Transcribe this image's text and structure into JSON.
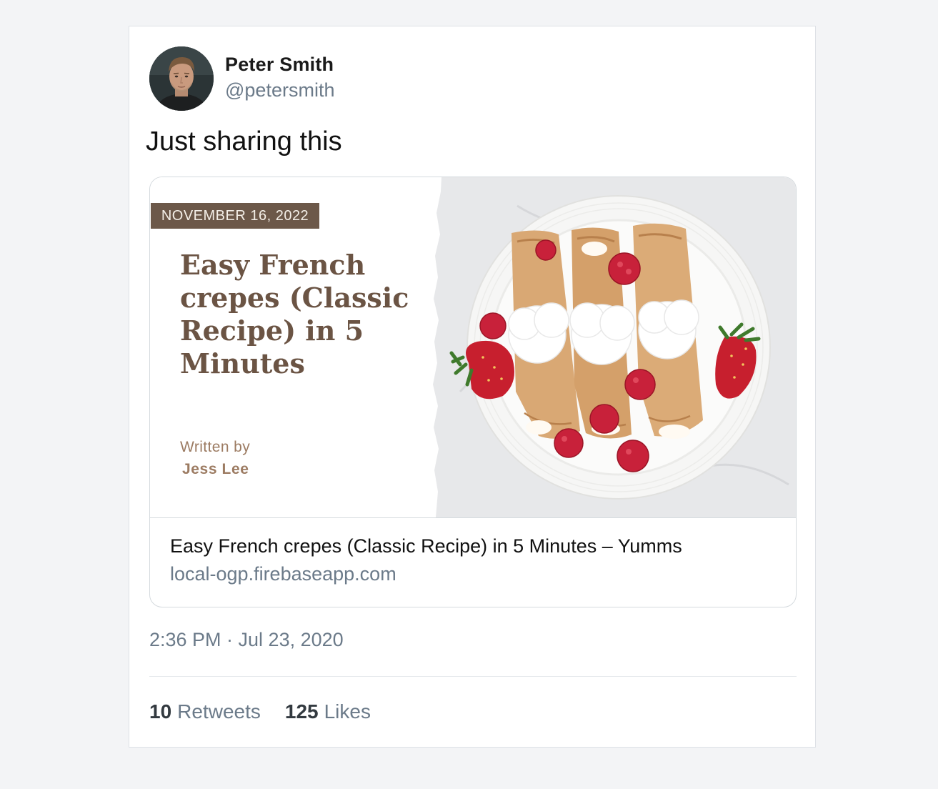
{
  "tweet": {
    "author": {
      "name": "Peter Smith",
      "handle": "@petersmith"
    },
    "text": "Just sharing this",
    "link_card": {
      "image": {
        "date": "NOVEMBER 16, 2022",
        "headline": "Easy French crepes (Classic Recipe) in 5 Minutes",
        "written_by": "Written by",
        "author": "Jess  Lee"
      },
      "title": "Easy French crepes (Classic Recipe) in 5 Minutes – Yumms",
      "domain": "local-ogp.firebaseapp.com"
    },
    "timestamp": "2:36 PM · Jul 23, 2020",
    "stats": {
      "retweets_count": "10",
      "retweets_label": "Retweets",
      "likes_count": "125",
      "likes_label": "Likes"
    }
  },
  "colors": {
    "page_background": "#f3f4f6",
    "muted_text": "#6b7a89",
    "preview_brown": "#6b5444",
    "date_banner": "#6c5849"
  }
}
